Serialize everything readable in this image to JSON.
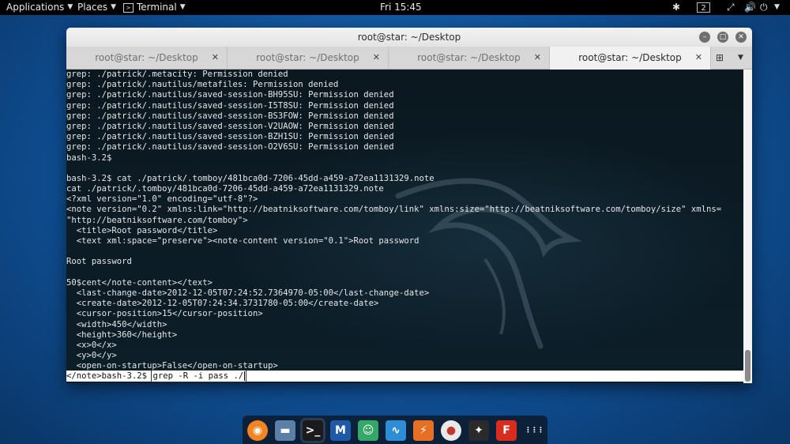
{
  "topbar": {
    "applications": "Applications",
    "places": "Places",
    "terminal": "Terminal",
    "clock": "Fri 15:45",
    "workspace": "2",
    "icons": [
      "window-manager-icon",
      "workspace-indicator",
      "network-icon",
      "volume-icon",
      "power-icon"
    ]
  },
  "window": {
    "title": "root@star: ~/Desktop",
    "tabs": [
      {
        "label": "root@star: ~/Desktop",
        "active": false
      },
      {
        "label": "root@star: ~/Desktop",
        "active": false
      },
      {
        "label": "root@star: ~/Desktop",
        "active": false
      },
      {
        "label": "root@star: ~/Desktop",
        "active": true
      }
    ]
  },
  "terminal": {
    "lines": [
      "grep: ./patrick/.metacity: Permission denied",
      "grep: ./patrick/.nautilus/metafiles: Permission denied",
      "grep: ./patrick/.nautilus/saved-session-BH95SU: Permission denied",
      "grep: ./patrick/.nautilus/saved-session-I5T8SU: Permission denied",
      "grep: ./patrick/.nautilus/saved-session-BS3FOW: Permission denied",
      "grep: ./patrick/.nautilus/saved-session-V2UAOW: Permission denied",
      "grep: ./patrick/.nautilus/saved-session-BZH1SU: Permission denied",
      "grep: ./patrick/.nautilus/saved-session-O2V6SU: Permission denied",
      "bash-3.2$",
      "",
      "bash-3.2$ cat ./patrick/.tomboy/481bca0d-7206-45dd-a459-a72ea1131329.note",
      "cat ./patrick/.tomboy/481bca0d-7206-45dd-a459-a72ea1131329.note",
      "<?xml version=\"1.0\" encoding=\"utf-8\"?>",
      "<note version=\"0.2\" xmlns:link=\"http://beatniksoftware.com/tomboy/link\" xmlns:size=\"http://beatniksoftware.com/tomboy/size\" xmlns=",
      "\"http://beatniksoftware.com/tomboy\">",
      "  <title>Root password</title>",
      "  <text xml:space=\"preserve\"><note-content version=\"0.1\">Root password",
      "",
      "Root password",
      "",
      "50$cent</note-content></text>",
      "  <last-change-date>2012-12-05T07:24:52.7364970-05:00</last-change-date>",
      "  <create-date>2012-12-05T07:24:34.3731780-05:00</create-date>",
      "  <cursor-position>15</cursor-position>",
      "  <width>450</width>",
      "  <height>360</height>",
      "  <x>0</x>",
      "  <y>0</y>",
      "  <open-on-startup>False</open-on-startup>"
    ],
    "prompt": "</note>bash-3.2$ ",
    "command": "grep -R -i pass ./"
  },
  "dock": {
    "apps": [
      {
        "name": "firefox-icon",
        "glyph": "◉",
        "color": "#f5831f"
      },
      {
        "name": "files-icon",
        "glyph": "▬",
        "color": "#5b7fa6"
      },
      {
        "name": "terminal-icon",
        "glyph": ">_",
        "color": "#1b1b1b"
      },
      {
        "name": "metasploit-icon",
        "glyph": "M",
        "color": "#1e5aa8"
      },
      {
        "name": "armitage-icon",
        "glyph": "☺",
        "color": "#35a868"
      },
      {
        "name": "wireshark-icon",
        "glyph": "∿",
        "color": "#2d8ed6"
      },
      {
        "name": "burpsuite-icon",
        "glyph": "⚡",
        "color": "#e76f24"
      },
      {
        "name": "maltego-icon",
        "glyph": "●",
        "color": "#e9e9e9"
      },
      {
        "name": "beef-icon",
        "glyph": "✦",
        "color": "#2a2a2a"
      },
      {
        "name": "faraday-icon",
        "glyph": "F",
        "color": "#d72d1f"
      },
      {
        "name": "show-apps-icon",
        "glyph": "⋮⋮⋮",
        "color": "transparent"
      }
    ]
  }
}
